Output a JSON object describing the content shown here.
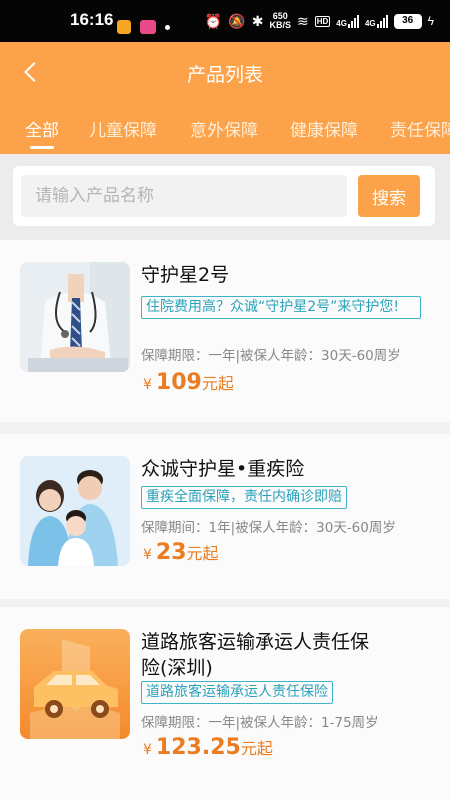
{
  "status_bar": {
    "time": "16:16",
    "net_speed_value": "650",
    "net_speed_unit": "KB/S",
    "hd": "HD",
    "signal1": "4G",
    "signal2": "4G",
    "battery": "36"
  },
  "header": {
    "title": "产品列表",
    "tabs": [
      "全部",
      "儿童保障",
      "意外保障",
      "健康保障",
      "责任保障"
    ],
    "active_tab": "全部"
  },
  "search": {
    "placeholder": "请输入产品名称",
    "button_label": "搜索"
  },
  "products": [
    {
      "name": "守护星2号",
      "tag": "住院费用高？众诚“守护星2号”来守护您!",
      "meta": "保障期限：一年|被保人年龄：30天-60周岁",
      "currency": "¥",
      "price": "109",
      "price_suffix": "元起"
    },
    {
      "name": "众诚守护星•重疾险",
      "tag": "重疾全面保障，责任内确诊即赔",
      "meta": "保障期间：1年|被保人年龄：30天-60周岁",
      "currency": "¥",
      "price": "23",
      "price_suffix": "元起"
    },
    {
      "name": "道路旅客运输承运人责任保险(深圳)",
      "tag": "道路旅客运输承运人责任保险",
      "meta": "保障期限：一年|被保人年龄：1-75周岁",
      "currency": "¥",
      "price": "123.25",
      "price_suffix": "元起"
    }
  ],
  "colors": {
    "brand": "#fba24a",
    "price": "#ea7d22",
    "tag": "#3fb3c8"
  }
}
